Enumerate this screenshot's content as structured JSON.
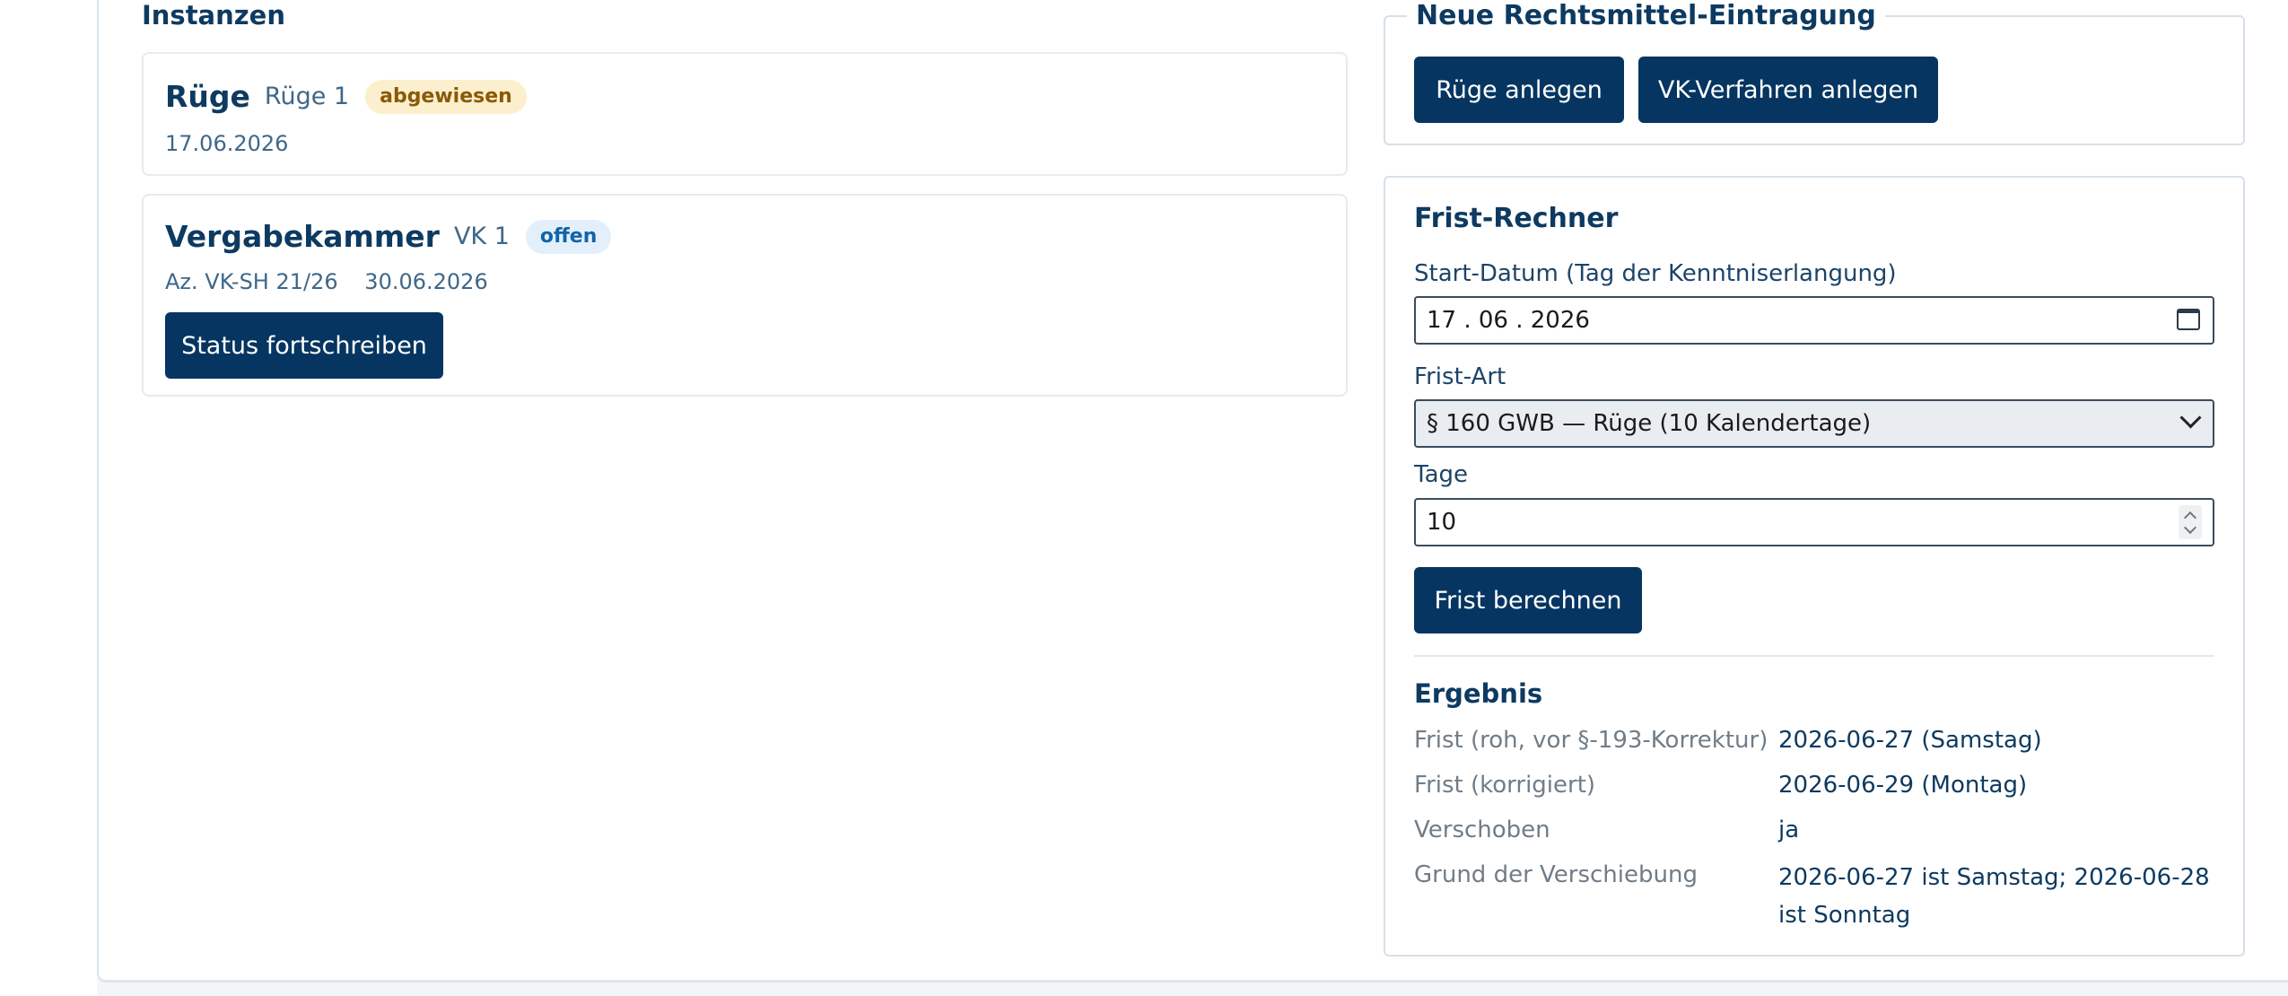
{
  "instances": {
    "heading": "Instanzen",
    "items": [
      {
        "type": "Rüge",
        "name": "Rüge 1",
        "badge": "abgewiesen",
        "date": "17.06.2026"
      },
      {
        "type": "Vergabekammer",
        "name": "VK 1",
        "badge": "offen",
        "reference": "Az. VK-SH 21/26",
        "date": "30.06.2026",
        "action_label": "Status fortschreiben"
      }
    ]
  },
  "new_entry": {
    "legend": "Neue Rechtsmittel-Eintragung",
    "add_ruge_label": "Rüge anlegen",
    "add_vk_label": "VK-Verfahren anlegen"
  },
  "calculator": {
    "title": "Frist-Rechner",
    "start_label": "Start-Datum (Tag der Kenntniserlangung)",
    "start_value": "17 . 06 . 2026",
    "art_label": "Frist-Art",
    "art_value": "§ 160 GWB — Rüge (10 Kalendertage)",
    "days_label": "Tage",
    "days_value": "10",
    "calculate_label": "Frist berechnen"
  },
  "result": {
    "title": "Ergebnis",
    "rows": [
      {
        "label": "Frist (roh, vor §-193-Korrektur)",
        "value": "2026-06-27 (Samstag)"
      },
      {
        "label": "Frist (korrigiert)",
        "value": "2026-06-29 (Montag)"
      },
      {
        "label": "Verschoben",
        "value": "ja"
      },
      {
        "label": "Grund der Verschiebung",
        "value": "2026-06-27 ist Samstag; 2026-06-28 ist Sonntag"
      }
    ]
  }
}
